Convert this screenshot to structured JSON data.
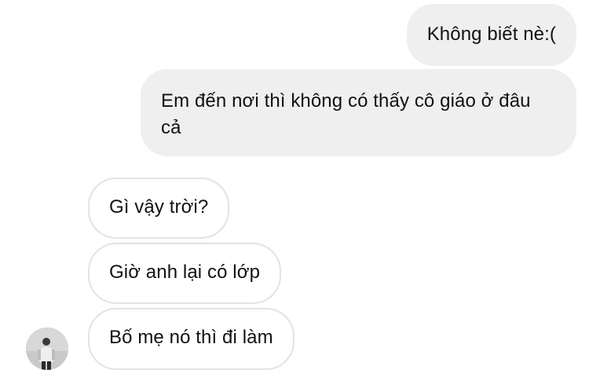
{
  "conversation": {
    "messages": [
      {
        "direction": "sent",
        "text": "Không biết nè:("
      },
      {
        "direction": "sent",
        "text": "Em đến nơi thì không có thấy cô giáo ở đâu cả"
      },
      {
        "direction": "received",
        "text": "Gì vậy trời?"
      },
      {
        "direction": "received",
        "text": "Giờ anh lại có lớp"
      },
      {
        "direction": "received",
        "text": "Bố mẹ nó thì đi làm"
      }
    ]
  },
  "colors": {
    "sent_bubble": "#efefef",
    "received_bubble_border": "#e3e3e3",
    "background": "#ffffff",
    "text": "#111111"
  }
}
